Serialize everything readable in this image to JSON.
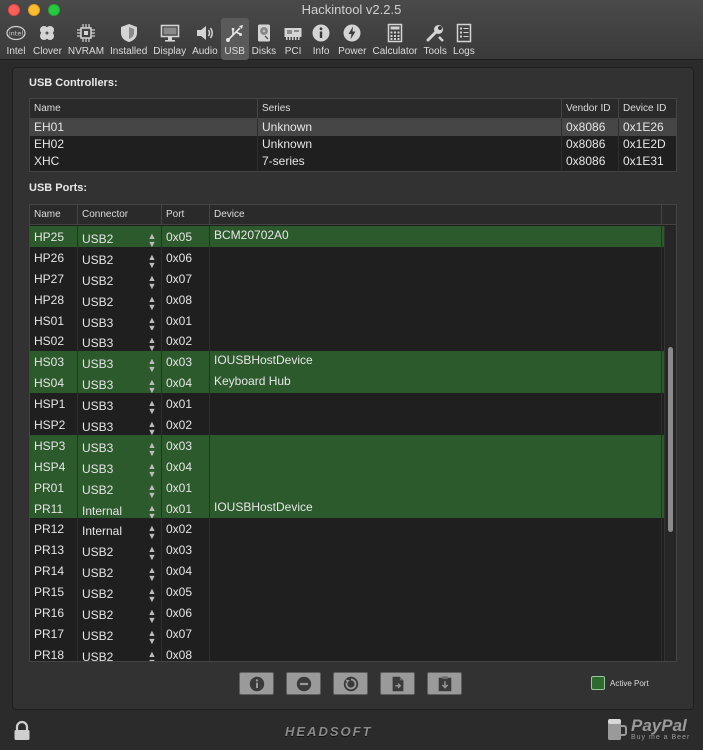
{
  "window": {
    "title": "Hackintool v2.2.5"
  },
  "toolbar": {
    "items": [
      {
        "label": "Intel",
        "icon": "intel-icon"
      },
      {
        "label": "Clover",
        "icon": "clover-icon"
      },
      {
        "label": "NVRAM",
        "icon": "chip-icon"
      },
      {
        "label": "Installed",
        "icon": "shield-icon"
      },
      {
        "label": "Display",
        "icon": "display-icon"
      },
      {
        "label": "Audio",
        "icon": "speaker-icon"
      },
      {
        "label": "USB",
        "icon": "usb-icon",
        "active": true
      },
      {
        "label": "Disks",
        "icon": "disk-icon"
      },
      {
        "label": "PCI",
        "icon": "pci-card-icon"
      },
      {
        "label": "Info",
        "icon": "info-icon"
      },
      {
        "label": "Power",
        "icon": "power-icon"
      },
      {
        "label": "Calculator",
        "icon": "calculator-icon"
      },
      {
        "label": "Tools",
        "icon": "wrench-icon"
      },
      {
        "label": "Logs",
        "icon": "logs-icon"
      }
    ],
    "intel_glyph": "intel"
  },
  "controllers": {
    "title": "USB Controllers:",
    "columns": [
      "Name",
      "Series",
      "Vendor ID",
      "Device ID"
    ],
    "rows": [
      {
        "name": "EH01",
        "series": "Unknown",
        "vendor": "0x8086",
        "device": "0x1E26",
        "selected": true
      },
      {
        "name": "EH02",
        "series": "Unknown",
        "vendor": "0x8086",
        "device": "0x1E2D"
      },
      {
        "name": "XHC",
        "series": "7-series",
        "vendor": "0x8086",
        "device": "0x1E31"
      }
    ]
  },
  "ports": {
    "title": "USB Ports:",
    "columns": [
      "Name",
      "Connector",
      "Port",
      "Device"
    ],
    "rows": [
      {
        "name": "HP25",
        "connector": "USB2",
        "port": "0x05",
        "device": "BCM20702A0",
        "active": true
      },
      {
        "name": "HP26",
        "connector": "USB2",
        "port": "0x06",
        "device": ""
      },
      {
        "name": "HP27",
        "connector": "USB2",
        "port": "0x07",
        "device": ""
      },
      {
        "name": "HP28",
        "connector": "USB2",
        "port": "0x08",
        "device": ""
      },
      {
        "name": "HS01",
        "connector": "USB3",
        "port": "0x01",
        "device": ""
      },
      {
        "name": "HS02",
        "connector": "USB3",
        "port": "0x02",
        "device": ""
      },
      {
        "name": "HS03",
        "connector": "USB3",
        "port": "0x03",
        "device": "IOUSBHostDevice",
        "active": true
      },
      {
        "name": "HS04",
        "connector": "USB3",
        "port": "0x04",
        "device": "Keyboard Hub",
        "active": true
      },
      {
        "name": "HSP1",
        "connector": "USB3",
        "port": "0x01",
        "device": ""
      },
      {
        "name": "HSP2",
        "connector": "USB3",
        "port": "0x02",
        "device": ""
      },
      {
        "name": "HSP3",
        "connector": "USB3",
        "port": "0x03",
        "device": "",
        "active": true
      },
      {
        "name": "HSP4",
        "connector": "USB3",
        "port": "0x04",
        "device": "",
        "active": true
      },
      {
        "name": "PR01",
        "connector": "USB2",
        "port": "0x01",
        "device": "",
        "active": true
      },
      {
        "name": "PR11",
        "connector": "Internal",
        "port": "0x01",
        "device": "IOUSBHostDevice",
        "active": true
      },
      {
        "name": "PR12",
        "connector": "Internal",
        "port": "0x02",
        "device": ""
      },
      {
        "name": "PR13",
        "connector": "USB2",
        "port": "0x03",
        "device": ""
      },
      {
        "name": "PR14",
        "connector": "USB2",
        "port": "0x04",
        "device": ""
      },
      {
        "name": "PR15",
        "connector": "USB2",
        "port": "0x05",
        "device": ""
      },
      {
        "name": "PR16",
        "connector": "USB2",
        "port": "0x06",
        "device": ""
      },
      {
        "name": "PR17",
        "connector": "USB2",
        "port": "0x07",
        "device": ""
      },
      {
        "name": "PR18",
        "connector": "USB2",
        "port": "0x08",
        "device": ""
      }
    ],
    "scroll_position": 0.45
  },
  "actions": [
    {
      "icon": "info-icon"
    },
    {
      "icon": "minus-circle-icon"
    },
    {
      "icon": "refresh-icon"
    },
    {
      "icon": "export-document-icon"
    },
    {
      "icon": "clipboard-icon"
    }
  ],
  "legend": {
    "label": "Active Port",
    "color": "#2d6a2d"
  },
  "footer": {
    "brand": "HEADSOFT",
    "paypal_name": "PayPal",
    "paypal_sub": "Buy me a Beer"
  },
  "colors": {
    "active_row": "#2d5a2d",
    "selected_row": "#464646",
    "background": "#2b2b2b"
  }
}
